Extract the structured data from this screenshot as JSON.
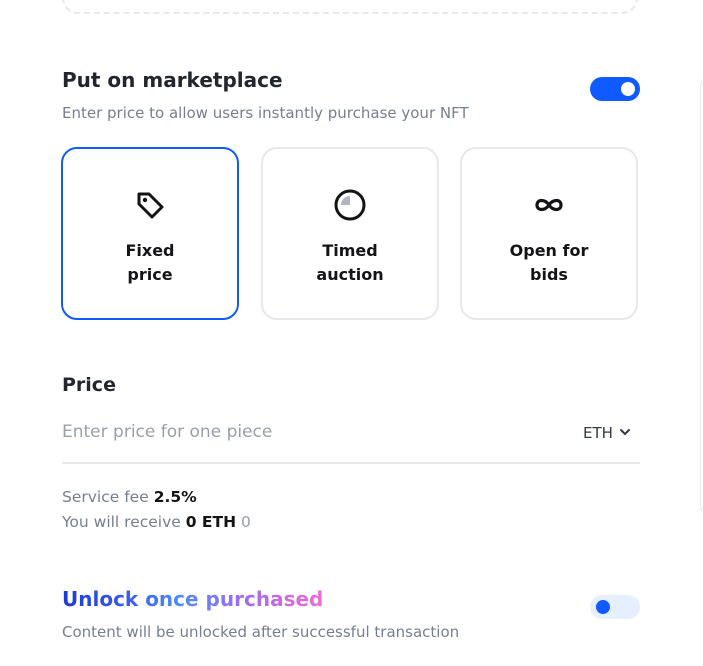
{
  "marketplace": {
    "title": "Put on marketplace",
    "subtitle": "Enter price to allow users instantly purchase your NFT",
    "toggle_on": true
  },
  "options": [
    {
      "label": "Fixed\nprice",
      "icon": "tag-icon",
      "selected": true
    },
    {
      "label": "Timed\nauction",
      "icon": "clock-icon",
      "selected": false
    },
    {
      "label": "Open for\nbids",
      "icon": "infinity-icon",
      "selected": false
    }
  ],
  "price": {
    "title": "Price",
    "placeholder": "Enter price for one piece",
    "value": "",
    "currency": "ETH"
  },
  "fees": {
    "service_fee_label": "Service fee",
    "service_fee_value": "2.5%",
    "receive_label": "You will receive",
    "receive_value": "0 ETH",
    "receive_fiat": "0"
  },
  "unlock": {
    "title": "Unlock once purchased",
    "subtitle": "Content will be unlocked after successful transaction",
    "toggle_on": false
  },
  "colors": {
    "accent": "#0f5bff",
    "border": "#e6e8ec",
    "muted_text": "#777e90"
  }
}
